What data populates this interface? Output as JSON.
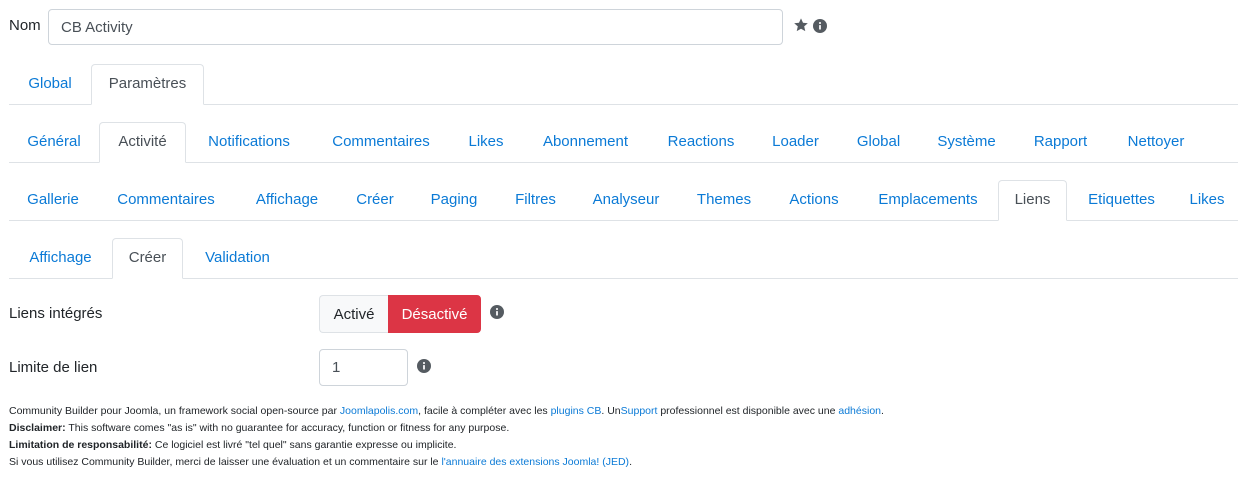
{
  "name_field": {
    "label": "Nom",
    "value": "CB Activity"
  },
  "icons": {
    "star": "star-icon",
    "info": "info-circle-icon"
  },
  "tabs_row1": [
    {
      "label": "Global",
      "active": false
    },
    {
      "label": "Paramètres",
      "active": true
    }
  ],
  "tabs_row2": [
    {
      "label": "Général",
      "active": false
    },
    {
      "label": "Activité",
      "active": true
    },
    {
      "label": "Notifications",
      "active": false
    },
    {
      "label": "Commentaires",
      "active": false
    },
    {
      "label": "Likes",
      "active": false
    },
    {
      "label": "Abonnement",
      "active": false
    },
    {
      "label": "Reactions",
      "active": false
    },
    {
      "label": "Loader",
      "active": false
    },
    {
      "label": "Global",
      "active": false
    },
    {
      "label": "Système",
      "active": false
    },
    {
      "label": "Rapport",
      "active": false
    },
    {
      "label": "Nettoyer",
      "active": false
    }
  ],
  "tabs_row3": [
    {
      "label": "Gallerie",
      "active": false
    },
    {
      "label": "Commentaires",
      "active": false
    },
    {
      "label": "Affichage",
      "active": false
    },
    {
      "label": "Créer",
      "active": false
    },
    {
      "label": "Paging",
      "active": false
    },
    {
      "label": "Filtres",
      "active": false
    },
    {
      "label": "Analyseur",
      "active": false
    },
    {
      "label": "Themes",
      "active": false
    },
    {
      "label": "Actions",
      "active": false
    },
    {
      "label": "Emplacements",
      "active": false
    },
    {
      "label": "Liens",
      "active": true
    },
    {
      "label": "Etiquettes",
      "active": false
    },
    {
      "label": "Likes",
      "active": false
    }
  ],
  "tabs_row4": [
    {
      "label": "Affichage",
      "active": false
    },
    {
      "label": "Créer",
      "active": true
    },
    {
      "label": "Validation",
      "active": false
    }
  ],
  "fields": {
    "embedded_links": {
      "label": "Liens intégrés",
      "on_label": "Activé",
      "off_label": "Désactivé",
      "value": "Désactivé"
    },
    "link_limit": {
      "label": "Limite de lien",
      "value": "1"
    }
  },
  "colors": {
    "link": "#0b7ad6",
    "danger": "#dc3545",
    "border": "#dee2e6"
  },
  "footer": {
    "line1": {
      "t1": "Community Builder pour Joomla, un framework social open-source par ",
      "link1": "Joomlapolis.com",
      "t2": ", facile à compléter avec les ",
      "link2": "plugins CB",
      "t3": ". Un",
      "link3": "Support",
      "t4": " professionnel est disponible avec une ",
      "link4": "adhésion",
      "t5": "."
    },
    "line2": {
      "bold": "Disclaimer:",
      "text": " This software comes \"as is\" with no guarantee for accuracy, function or fitness for any purpose."
    },
    "line3": {
      "bold": "Limitation de responsabilité:",
      "text": " Ce logiciel est livré \"tel quel\" sans garantie expresse ou implicite."
    },
    "line4": {
      "text": "Si vous utilisez Community Builder, merci de laisser une évaluation et un commentaire sur le ",
      "link": "l'annuaire des extensions Joomla! (JED)",
      "end": "."
    }
  }
}
